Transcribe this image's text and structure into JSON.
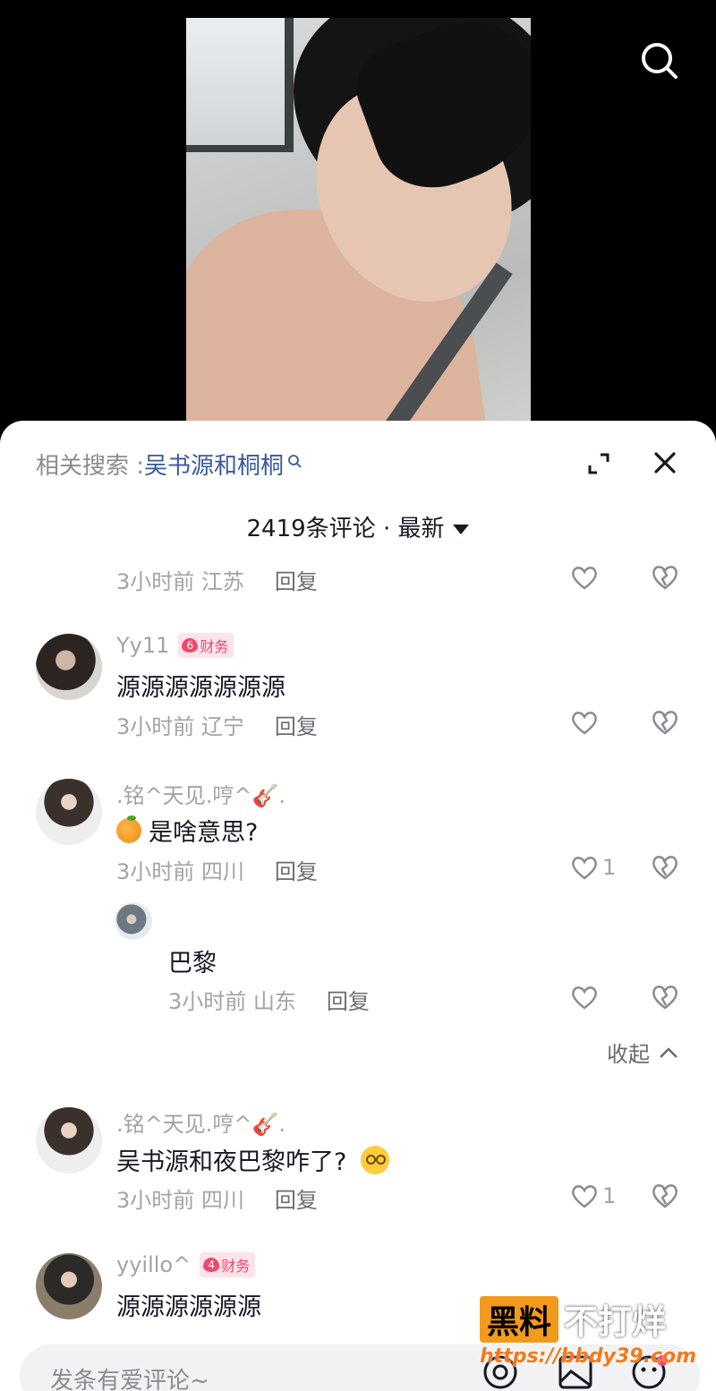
{
  "related_search": {
    "prefix": "相关搜索 : ",
    "keyword": "吴书源和桐桐"
  },
  "comments_header": {
    "count_label": "2419条评论 · 最新"
  },
  "comments": [
    {
      "meta_time": "3小时前 江苏",
      "reply": "回复"
    },
    {
      "username": "Yy11",
      "badge_level": "6",
      "badge_label": "财务",
      "text": "源源源源源源源",
      "meta_time": "3小时前 辽宁",
      "reply": "回复"
    },
    {
      "username": ".铭^天见.哼^🎸.",
      "text": "是啥意思?",
      "meta_time": "3小时前 四川",
      "reply": "回复",
      "likes": "1"
    },
    {
      "text": "巴黎",
      "meta_time": "3小时前 山东",
      "reply": "回复"
    },
    {
      "username": ".铭^天见.哼^🎸.",
      "text": "吴书源和夜巴黎咋了?",
      "meta_time": "3小时前 四川",
      "reply": "回复",
      "likes": "1"
    },
    {
      "username": "yyillo^",
      "badge_level": "4",
      "badge_label": "财务",
      "text": "源源源源源源"
    }
  ],
  "collapse_label": "收起",
  "input": {
    "placeholder": "发条有爱评论~"
  },
  "watermark": {
    "brand_box": "黑料",
    "brand_rest": "不打烊",
    "url": "https://bbdy39.com"
  },
  "colors": {
    "accent_link": "#3b5998",
    "badge": "#f2466b",
    "watermark": "#f29a1b"
  }
}
